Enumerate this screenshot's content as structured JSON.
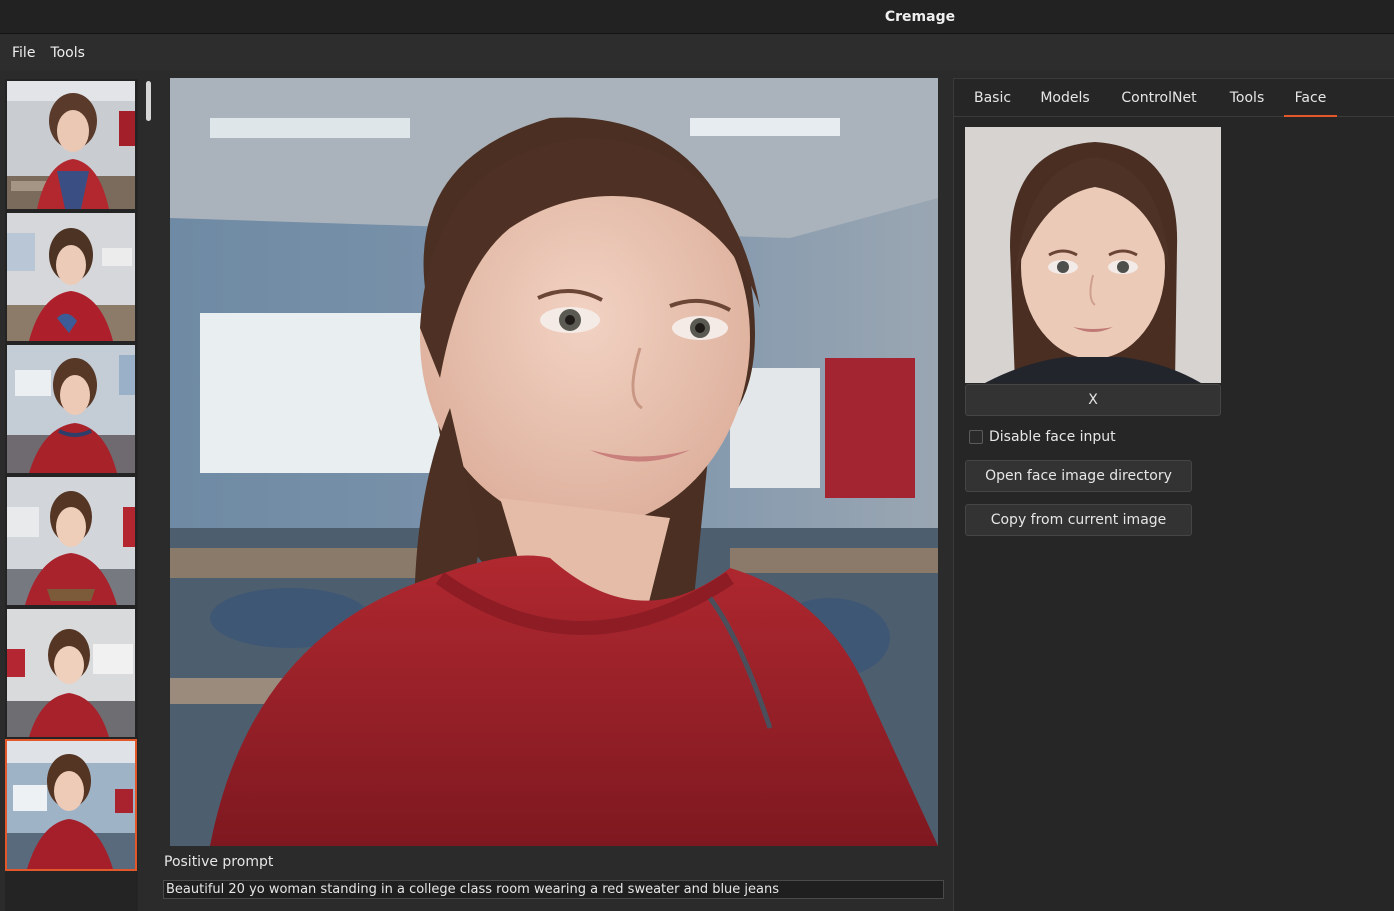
{
  "window": {
    "title": "Cremage"
  },
  "menu": {
    "items": [
      "File",
      "Tools"
    ]
  },
  "thumbnails": {
    "count": 6,
    "selected_index": 5
  },
  "prompt": {
    "label": "Positive prompt",
    "value": "Beautiful 20 yo woman standing in a college class room wearing a red sweater and blue jeans"
  },
  "right_panel": {
    "tabs": [
      "Basic",
      "Models",
      "ControlNet",
      "Tools",
      "Face"
    ],
    "active_tab": "Face",
    "clear_button_label": "X",
    "disable_face_label": "Disable face input",
    "disable_face_checked": false,
    "open_dir_label": "Open face image directory",
    "copy_label": "Copy from current image"
  },
  "colors": {
    "accent": "#e2582b",
    "background": "#2b2b2b",
    "sweater": "#9a1e24"
  }
}
